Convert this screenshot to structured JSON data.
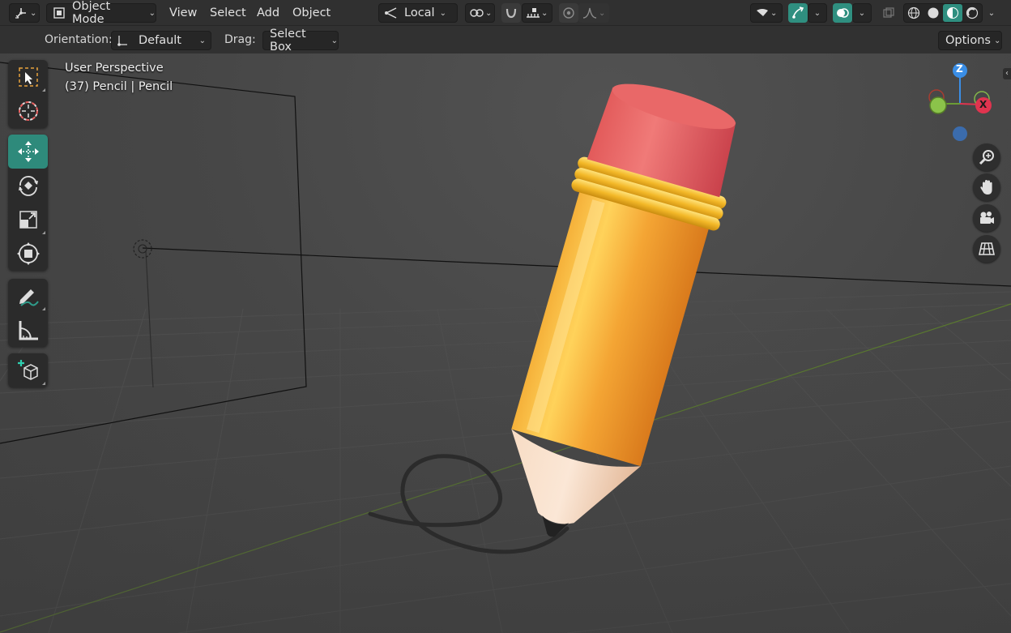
{
  "header": {
    "mode_label": "Object Mode",
    "menus": [
      "View",
      "Select",
      "Add",
      "Object"
    ],
    "transform_orientation": "Local",
    "editor_icon": "axes-icon",
    "accent_color": "#2f8f80"
  },
  "toolsettings": {
    "orientation_label": "Orientation:",
    "orientation_value": "Default",
    "drag_label": "Drag:",
    "drag_value": "Select Box",
    "options_label": "Options"
  },
  "viewport": {
    "view_name": "User Perspective",
    "object_info": "(37) Pencil | Pencil"
  },
  "toolbar": {
    "tools": [
      {
        "name": "select-box-tool",
        "icon": "cursor-select-icon",
        "active": false
      },
      {
        "name": "cursor-tool",
        "icon": "3d-cursor-icon",
        "active": false
      },
      {
        "name": "move-tool",
        "icon": "move-icon",
        "active": true
      },
      {
        "name": "rotate-tool",
        "icon": "rotate-icon",
        "active": false
      },
      {
        "name": "scale-tool",
        "icon": "scale-icon",
        "active": false
      },
      {
        "name": "transform-tool",
        "icon": "transform-icon",
        "active": false
      },
      {
        "name": "annotate-tool",
        "icon": "annotate-icon",
        "active": false
      },
      {
        "name": "measure-tool",
        "icon": "measure-icon",
        "active": false
      },
      {
        "name": "add-cube-tool",
        "icon": "add-cube-icon",
        "active": false
      }
    ]
  },
  "gizmo": {
    "z_label": "Z",
    "x_label": "X",
    "x_color": "#e0344f",
    "y_color": "#8bc34a",
    "z_color": "#3a8ee6"
  },
  "navigation": [
    "zoom-icon",
    "pan-hand-icon",
    "camera-icon",
    "grid-ortho-icon"
  ]
}
